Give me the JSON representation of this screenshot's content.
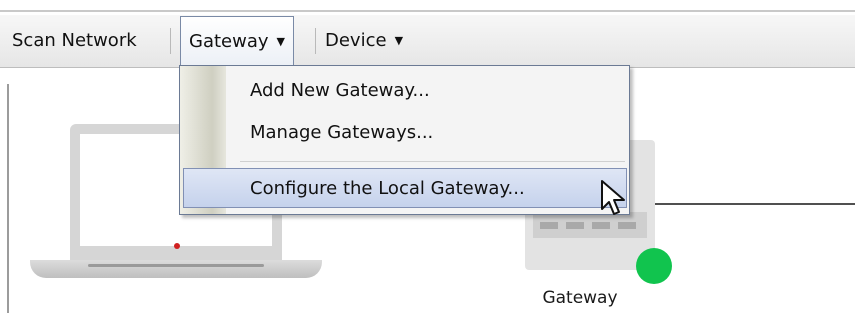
{
  "toolbar": {
    "scan_network": "Scan Network",
    "gateway": "Gateway",
    "device": "Device"
  },
  "gateway_menu": {
    "items": [
      {
        "label": "Add New Gateway..."
      },
      {
        "label": "Manage Gateways..."
      },
      {
        "label": "Configure the Local Gateway...",
        "highlighted": true
      }
    ]
  },
  "canvas": {
    "gateway_label": "Gateway",
    "gateway_status_color": "#11c44e"
  },
  "icons": {
    "dropdown": "chevron-down-icon",
    "cursor": "mouse-pointer-icon"
  }
}
